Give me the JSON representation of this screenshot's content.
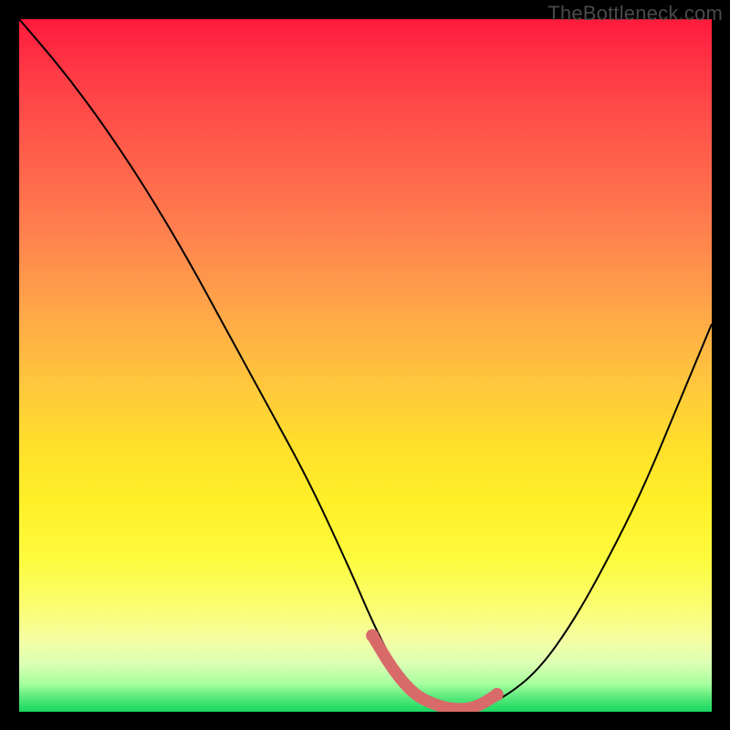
{
  "watermark": "TheBottleneck.com",
  "chart_data": {
    "type": "line",
    "title": "",
    "xlabel": "",
    "ylabel": "",
    "xlim": [
      0,
      100
    ],
    "ylim": [
      0,
      100
    ],
    "grid": false,
    "legend": false,
    "series": [
      {
        "name": "curve",
        "x": [
          0,
          6,
          12,
          18,
          24,
          30,
          36,
          42,
          48,
          51,
          54,
          57,
          60,
          63,
          66,
          70,
          75,
          80,
          85,
          90,
          95,
          100
        ],
        "values": [
          100,
          93,
          85,
          76,
          66,
          55,
          44,
          33,
          20,
          13,
          7,
          3,
          1,
          0.3,
          0.5,
          2,
          6,
          13,
          22,
          32,
          44,
          56
        ]
      }
    ],
    "highlight_segment": {
      "name": "optimal-zone",
      "x": [
        51,
        54,
        57,
        60,
        63,
        66,
        69
      ],
      "values": [
        11,
        6,
        2.5,
        1,
        0.3,
        0.6,
        2.5
      ]
    },
    "background_gradient": {
      "stops": [
        {
          "pos": 0.0,
          "color": "#ff1a3c"
        },
        {
          "pos": 0.5,
          "color": "#ffd23a"
        },
        {
          "pos": 0.9,
          "color": "#f3ffa6"
        },
        {
          "pos": 1.0,
          "color": "#18d860"
        }
      ]
    }
  }
}
